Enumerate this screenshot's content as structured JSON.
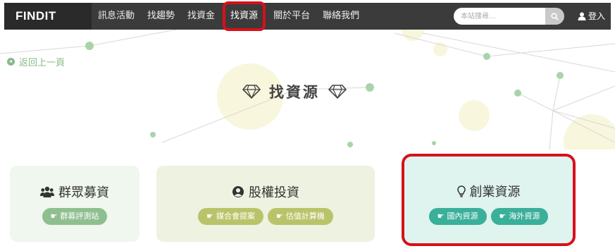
{
  "nav": {
    "logo": "FINDIT",
    "items": [
      {
        "label": "訊息活動"
      },
      {
        "label": "找趨勢"
      },
      {
        "label": "找資金"
      },
      {
        "label": "找資源"
      },
      {
        "label": "關於平台"
      },
      {
        "label": "聯絡我們"
      }
    ],
    "active_item": "找資源",
    "search_placeholder": "本站搜尋...",
    "login": "登入"
  },
  "back_link": "返回上一頁",
  "page_title": "找資源",
  "cards": [
    {
      "title": "群眾募資",
      "icon": "users-icon",
      "buttons": [
        "群募評測站"
      ],
      "bg": "#f0f7ee",
      "btn_color": "#8fbf8f"
    },
    {
      "title": "股權投資",
      "icon": "user-circle-icon",
      "buttons": [
        "媒合會提案",
        "估值計算機"
      ],
      "bg": "#eef2e0",
      "btn_color": "#b9c46a"
    },
    {
      "title": "創業資源",
      "icon": "lightbulb-icon",
      "buttons": [
        "國內資源",
        "海外資源"
      ],
      "bg": "#dff3ef",
      "btn_color": "#3aaf9a"
    }
  ],
  "colors": {
    "nav_bg": "#3b3b3b",
    "logo_bg": "#2a2a2a",
    "highlight": "#d6111a",
    "accent_green": "#8ab98a"
  }
}
